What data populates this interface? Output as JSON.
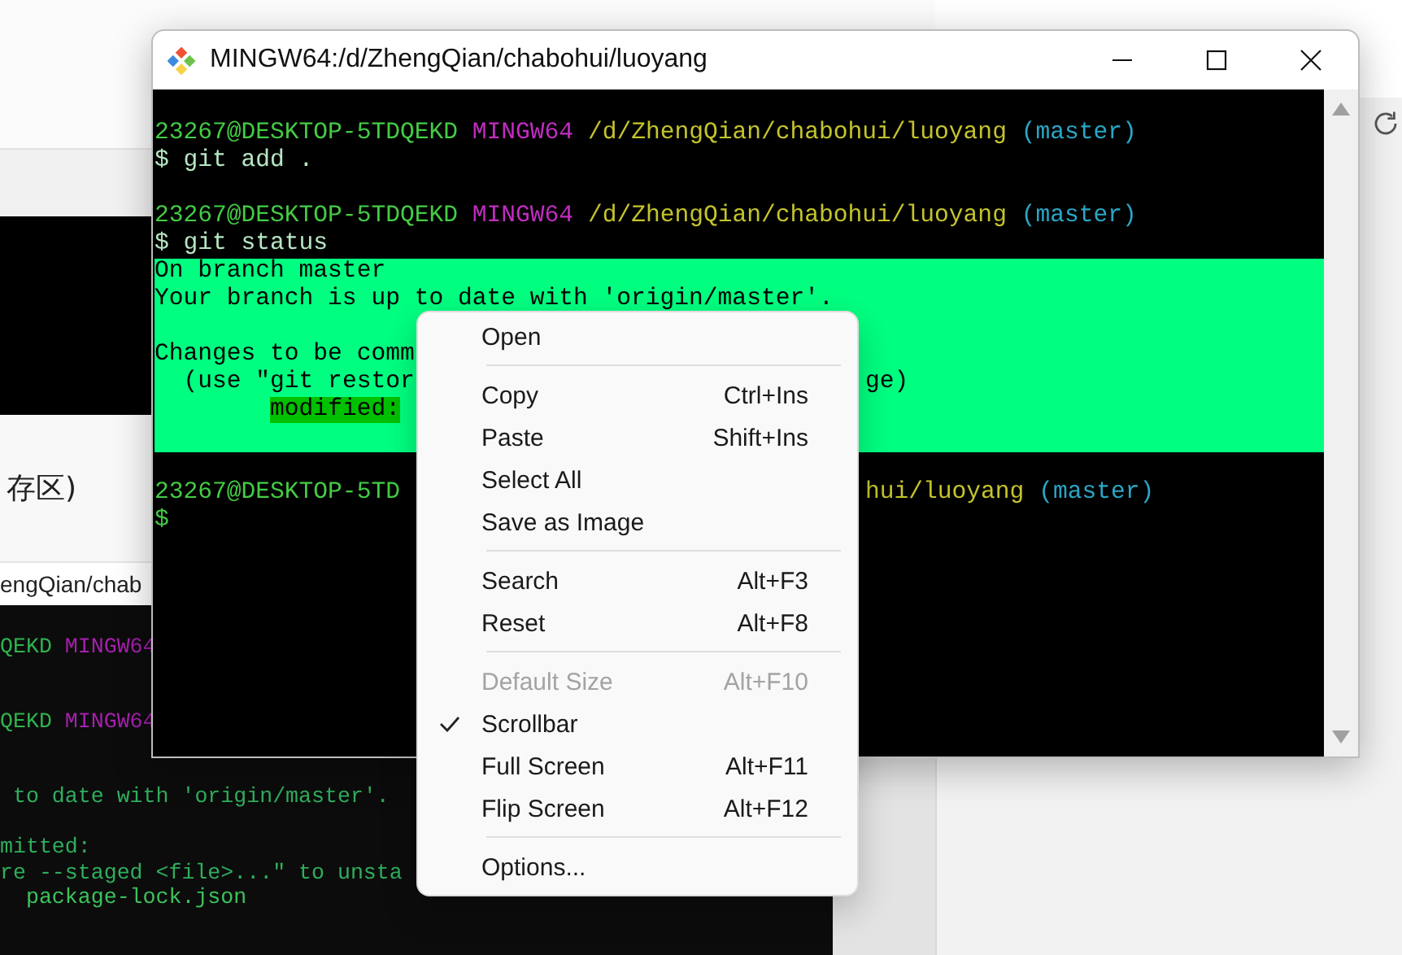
{
  "background": {
    "caption": "存区)",
    "title": "engQian/chab",
    "terminal_lines": [
      {
        "segments": [
          {
            "text": "QEKD",
            "color": "#2fb34f"
          },
          {
            "text": " MINGW64",
            "color": "#a81fb0"
          }
        ]
      },
      {
        "segments": [
          {
            "text": "QEKD",
            "color": "#2fb34f"
          },
          {
            "text": " MINGW64",
            "color": "#a81fb0"
          }
        ]
      },
      {
        "segments": [
          {
            "text": " to date with 'origin/master'.",
            "color": "#2fae5c"
          }
        ]
      },
      {
        "segments": [
          {
            "text": "mitted:",
            "color": "#2fae5c"
          }
        ]
      },
      {
        "segments": [
          {
            "text": "re --staged <file>...\" to unsta",
            "color": "#2fae5c"
          }
        ]
      },
      {
        "segments": [
          {
            "text": "  package-lock.json",
            "color": "#3cc25c"
          }
        ]
      }
    ]
  },
  "window": {
    "title": "MINGW64:/d/ZhengQian/chabohui/luoyang",
    "lines": [
      {
        "highlighted": false
      },
      {
        "highlighted": false,
        "segments": [
          {
            "text": "23267@DESKTOP-5TDQEKD",
            "color": "#44cc44",
            "marked": false
          },
          {
            "text": " MINGW64",
            "color": "#c22cc2",
            "marked": false
          },
          {
            "text": " /d/ZhengQian/chabohui/luoyang",
            "color": "#c4c42c",
            "marked": false
          },
          {
            "text": " (master)",
            "color": "#2aa6c6",
            "marked": false
          }
        ]
      },
      {
        "highlighted": false,
        "segments": [
          {
            "text": "$ git add .",
            "color": "#b6e6c2",
            "marked": false
          }
        ]
      },
      {
        "highlighted": false
      },
      {
        "highlighted": false,
        "segments": [
          {
            "text": "23267@DESKTOP-5TDQEKD",
            "color": "#44cc44",
            "marked": false
          },
          {
            "text": " MINGW64",
            "color": "#c22cc2",
            "marked": false
          },
          {
            "text": " /d/ZhengQian/chabohui/luoyang",
            "color": "#c4c42c",
            "marked": false
          },
          {
            "text": " (master)",
            "color": "#2aa6c6",
            "marked": false
          }
        ]
      },
      {
        "highlighted": false,
        "segments": [
          {
            "text": "$ git status",
            "color": "#b6e6c2",
            "marked": false
          }
        ]
      },
      {
        "highlighted": true,
        "segments": [
          {
            "text": "On branch master",
            "marked": false
          }
        ]
      },
      {
        "highlighted": true,
        "segments": [
          {
            "text": "Your branch is up to date with 'origin/master'.",
            "marked": false
          }
        ]
      },
      {
        "highlighted": true
      },
      {
        "highlighted": true,
        "segments": [
          {
            "text": "Changes to be comm",
            "marked": false
          }
        ]
      },
      {
        "highlighted": true,
        "segments": [
          {
            "text": "  (use \"git restor",
            "marked": false
          }
        ],
        "right_segments": [
          {
            "text": "ge)",
            "marked": false
          }
        ]
      },
      {
        "highlighted": true,
        "segments": [
          {
            "text": "\tmodified:",
            "marked": true
          }
        ]
      },
      {
        "highlighted": true
      },
      {
        "highlighted": false
      },
      {
        "highlighted": false,
        "segments": [
          {
            "text": "23267@DESKTOP-5TD",
            "color": "#44cc44",
            "marked": false
          }
        ],
        "right_segments": [
          {
            "text": "hui/luoyang",
            "color": "#c4c42c",
            "marked": false
          },
          {
            "text": " (master)",
            "color": "#2aa6c6",
            "marked": false
          }
        ]
      },
      {
        "highlighted": false,
        "segments": [
          {
            "text": "$",
            "color": "#44cc44",
            "marked": false
          }
        ]
      }
    ]
  },
  "context_menu": {
    "groups": [
      {
        "items": [
          {
            "label": "Open",
            "disabled": false,
            "checked": false
          }
        ]
      },
      {
        "items": [
          {
            "label": "Copy",
            "shortcut": "Ctrl+Ins",
            "disabled": false,
            "checked": false
          },
          {
            "label": "Paste",
            "shortcut": "Shift+Ins",
            "disabled": false,
            "checked": false
          },
          {
            "label": "Select All",
            "disabled": false,
            "checked": false
          },
          {
            "label": "Save as Image",
            "disabled": false,
            "checked": false
          }
        ]
      },
      {
        "items": [
          {
            "label": "Search",
            "shortcut": "Alt+F3",
            "disabled": false,
            "checked": false
          },
          {
            "label": "Reset",
            "shortcut": "Alt+F8",
            "disabled": false,
            "checked": false
          }
        ]
      },
      {
        "items": [
          {
            "label": "Default Size",
            "shortcut": "Alt+F10",
            "disabled": true,
            "checked": false
          },
          {
            "label": "Scrollbar",
            "disabled": false,
            "checked": true
          },
          {
            "label": "Full Screen",
            "shortcut": "Alt+F11",
            "disabled": false,
            "checked": false
          },
          {
            "label": "Flip Screen",
            "shortcut": "Alt+F12",
            "disabled": false,
            "checked": false
          }
        ]
      },
      {
        "items": [
          {
            "label": "Options...",
            "disabled": false,
            "checked": false
          }
        ]
      }
    ]
  }
}
